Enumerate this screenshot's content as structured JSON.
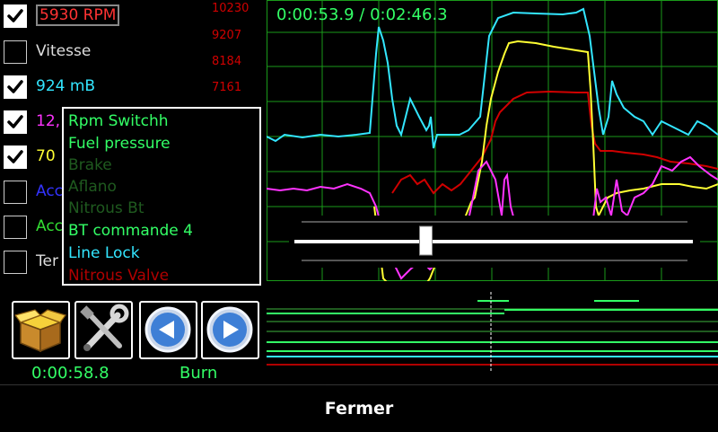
{
  "channels": [
    {
      "checked": true,
      "label": "5930 RPM",
      "color": "#ff3333",
      "boxed": true
    },
    {
      "checked": false,
      "label": "Vitesse",
      "color": "#dddddd"
    },
    {
      "checked": true,
      "label": "924 mB",
      "color": "#33e6ff"
    },
    {
      "checked": true,
      "label": "12,",
      "color": "#ff33ff"
    },
    {
      "checked": true,
      "label": "70",
      "color": "#ffff33"
    },
    {
      "checked": false,
      "label": "Acc",
      "color": "#3333ff"
    },
    {
      "checked": false,
      "label": "Acc",
      "color": "#33dd33"
    },
    {
      "checked": false,
      "label": "Ter",
      "color": "#dddddd"
    }
  ],
  "scale": [
    "10230",
    "9207",
    "8184",
    "7161"
  ],
  "time_display": "0:00:53.9 / 0:02:46.3",
  "digital_menu": [
    {
      "label": "Rpm Switchh",
      "color": "#33ff66"
    },
    {
      "label": "Fuel pressure",
      "color": "#33ff66"
    },
    {
      "label": "Brake",
      "color": "#1f5a1f"
    },
    {
      "label": "Aflano",
      "color": "#1f5a1f"
    },
    {
      "label": "Nitrous Bt",
      "color": "#1f5a1f"
    },
    {
      "label": "BT commande 4",
      "color": "#33ff66"
    },
    {
      "label": "Line Lock",
      "color": "#33e6ff"
    },
    {
      "label": "Nitrous Valve",
      "color": "#b00000"
    }
  ],
  "slider": {
    "position": 0.33
  },
  "toolbar": {
    "package_icon": "package-icon",
    "tools_icon": "tools-icon",
    "prev_icon": "previous-arrow-icon",
    "next_icon": "next-arrow-icon"
  },
  "status": {
    "elapsed": "0:00:58.8",
    "mode": "Burn"
  },
  "footer": {
    "close_label": "Fermer"
  },
  "colors": {
    "grid": "#1a9a1a",
    "accent": "#33ff66"
  }
}
